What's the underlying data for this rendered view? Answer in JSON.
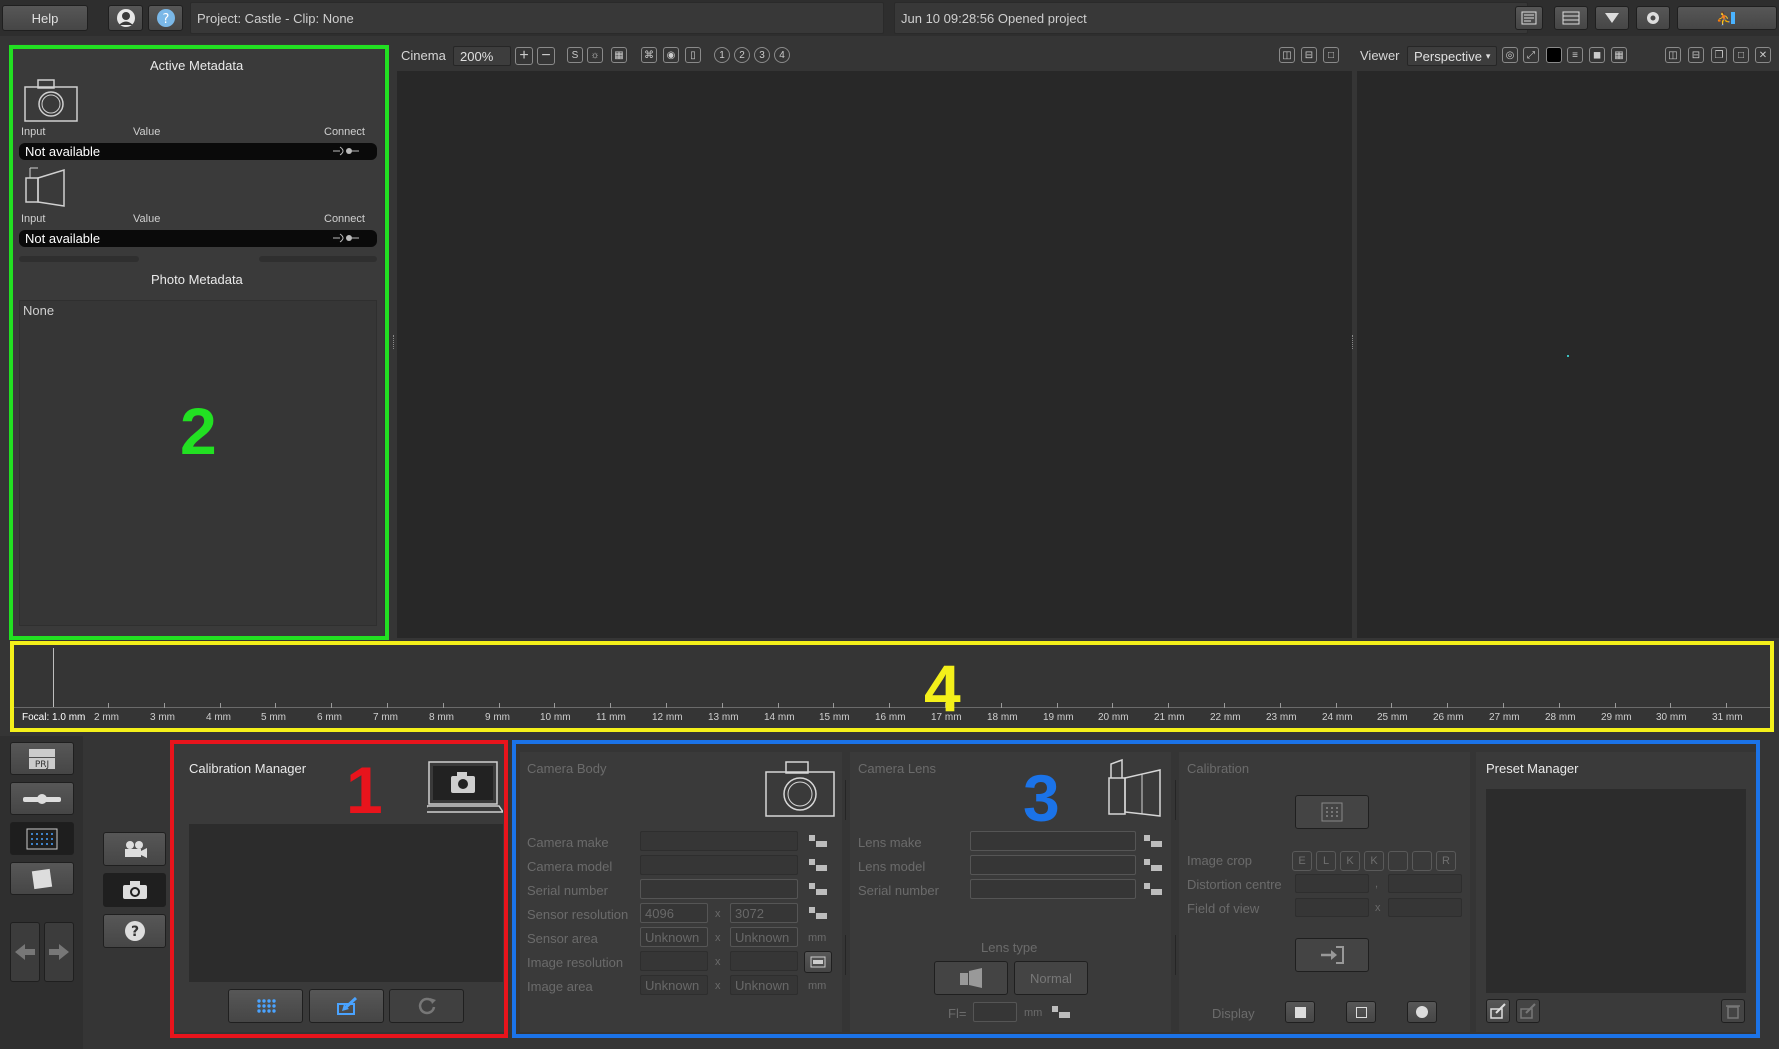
{
  "topbar": {
    "help_label": "Help",
    "project_info": "Project: Castle - Clip: None",
    "status_message": "Jun 10 09:28:56 Opened project"
  },
  "cinema": {
    "label": "Cinema",
    "zoom": "200%",
    "s_label": "S",
    "page_buttons": [
      "1",
      "2",
      "3",
      "4"
    ]
  },
  "viewer": {
    "label": "Viewer",
    "mode": "Perspective"
  },
  "metadata": {
    "active_title": "Active Metadata",
    "col_input": "Input",
    "col_value": "Value",
    "col_connect": "Connect",
    "camera_value": "Not available",
    "lens_value": "Not available",
    "photo_title": "Photo Metadata",
    "photo_value": "None"
  },
  "timeline": {
    "focal_label": "Focal: 1.0 mm",
    "ticks": [
      "2 mm",
      "3 mm",
      "4 mm",
      "5 mm",
      "6 mm",
      "7 mm",
      "8 mm",
      "9 mm",
      "10 mm",
      "11 mm",
      "12 mm",
      "13 mm",
      "14 mm",
      "15 mm",
      "16 mm",
      "17 mm",
      "18 mm",
      "19 mm",
      "20 mm",
      "21 mm",
      "22 mm",
      "23 mm",
      "24 mm",
      "25 mm",
      "26 mm",
      "27 mm",
      "28 mm",
      "29 mm",
      "30 mm",
      "31 mm"
    ]
  },
  "left_toolbar": {
    "prj_label": "PRJ"
  },
  "calibration_manager": {
    "title": "Calibration Manager"
  },
  "camera_body": {
    "title": "Camera Body",
    "camera_make": "Camera make",
    "camera_model": "Camera model",
    "serial_number": "Serial number",
    "sensor_resolution": "Sensor resolution",
    "sensor_res_w": "4096",
    "sensor_res_h": "3072",
    "sensor_area": "Sensor area",
    "sensor_area_w": "Unknown",
    "sensor_area_h": "Unknown",
    "image_resolution": "Image resolution",
    "image_area": "Image area",
    "image_area_w": "Unknown",
    "image_area_h": "Unknown",
    "x_sep": "x",
    "mm_unit": "mm"
  },
  "camera_lens": {
    "title": "Camera Lens",
    "lens_make": "Lens make",
    "lens_model": "Lens model",
    "serial_number": "Serial number",
    "lens_type": "Lens type",
    "normal_label": "Normal",
    "fl_label": "Fl=",
    "mm_unit": "mm"
  },
  "calibration": {
    "title": "Calibration",
    "image_crop": "Image crop",
    "crop_buttons": [
      "E",
      "L",
      "K",
      "K",
      "",
      "",
      "R"
    ],
    "distortion_centre": "Distortion centre",
    "field_of_view": "Field of view",
    "display_label": "Display",
    "comma": ",",
    "x_sep": "x"
  },
  "preset_manager": {
    "title": "Preset Manager"
  },
  "annotations": {
    "n1": "1",
    "n2": "2",
    "n3": "3",
    "n4": "4"
  },
  "colors": {
    "red": "#e8141c",
    "green": "#22e022",
    "blue": "#1b73e8",
    "yellow": "#f4f01a"
  }
}
